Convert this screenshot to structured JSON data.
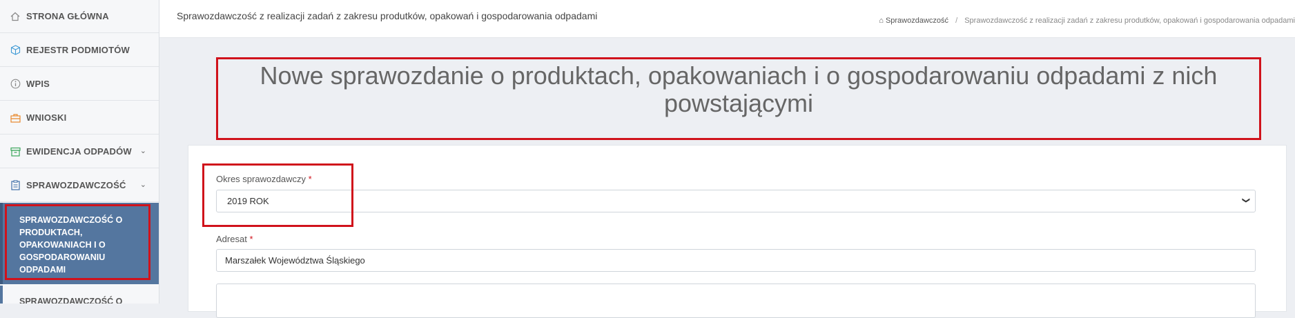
{
  "sidebar": {
    "items": [
      {
        "label": "STRONA GŁÓWNA",
        "icon": "home-icon"
      },
      {
        "label": "REJESTR PODMIOTÓW",
        "icon": "cube-icon"
      },
      {
        "label": "WPIS",
        "icon": "info-icon"
      },
      {
        "label": "WNIOSKI",
        "icon": "briefcase-icon"
      },
      {
        "label": "EWIDENCJA ODPADÓW",
        "icon": "archive-icon"
      },
      {
        "label": "SPRAWOZDAWCZOŚĆ",
        "icon": "clipboard-icon"
      }
    ],
    "active_sub": "SPRAWOZDAWCZOŚĆ O PRODUKTACH, OPAKOWANIACH I O GOSPODAROWANIU ODPADAMI",
    "next_sub": "SPRAWOZDAWCZOŚĆ O"
  },
  "header": {
    "title": "Sprawozdawczość z realizacji zadań z zakresu produtków, opakowań i gospodarowania odpadami",
    "breadcrumb_home": "Sprawozdawczość",
    "breadcrumb_sep": "/",
    "breadcrumb_current": "Sprawozdawczość z realizacji zadań z zakresu produtków, opakowań i gospodarowania odpadami"
  },
  "page": {
    "heading": "Nowe sprawozdanie o produktach, opakowaniach i o gospodarowaniu odpadami z nich powstającymi"
  },
  "form": {
    "period_label": "Okres sprawozdawczy",
    "period_value": "2019 ROK",
    "addressee_label": "Adresat",
    "addressee_value": "Marszałek Województwa Śląskiego",
    "required_mark": "*"
  },
  "colors": {
    "accent": "#54769f",
    "highlight": "#d0121b"
  }
}
